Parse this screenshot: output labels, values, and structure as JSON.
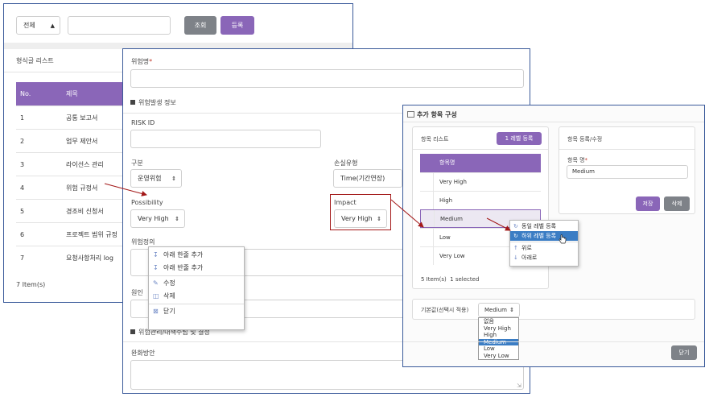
{
  "list_window": {
    "filter_select": "전체",
    "search_button": "조회",
    "register_button": "등록",
    "title": "형식글 리스트",
    "columns": [
      "No.",
      "제목"
    ],
    "rows": [
      {
        "no": "1",
        "title": "공통 보고서"
      },
      {
        "no": "2",
        "title": "업무 제안서"
      },
      {
        "no": "3",
        "title": "라이선스 관리"
      },
      {
        "no": "4",
        "title": "위험 규정서"
      },
      {
        "no": "5",
        "title": "경조비 신청서"
      },
      {
        "no": "6",
        "title": "프로젝트 범위 규정"
      },
      {
        "no": "7",
        "title": "요청사항처리 log"
      }
    ],
    "item_count": "7 Item(s)"
  },
  "form_window": {
    "risk_name_label": "위험명",
    "required_mark": "*",
    "section_occurrence": "위험발생 정보",
    "risk_id_label": "RISK ID",
    "category_label": "구분",
    "category_value": "운영위험",
    "loss_type_label": "손실유형",
    "loss_type_value": "Time(기간연장)",
    "possibility_label": "Possibility",
    "possibility_value": "Very High",
    "impact_label": "Impact",
    "impact_value": "Very High",
    "risk_definition_label": "위험정의",
    "cause_label": "원인",
    "section_mitigation": "위험관리/대책수립 및 결정",
    "mitigation_label": "완화방안"
  },
  "context_menu_1": {
    "items": [
      {
        "label": "아래 한줄 추가",
        "icon": "row-add-icon"
      },
      {
        "label": "아래 반줄 추가",
        "icon": "row-add-icon"
      },
      {
        "label": "수정",
        "icon": "edit-icon"
      },
      {
        "label": "삭제",
        "icon": "trash-icon"
      },
      {
        "label": "닫기",
        "icon": "close-box-icon"
      }
    ]
  },
  "config_window": {
    "title": "추가 항목 구성",
    "list_title": "항목 리스트",
    "level_button": "1 레벨 등록",
    "column_header": "항목명",
    "items": [
      "Very High",
      "High",
      "Medium",
      "Low",
      "Very Low"
    ],
    "selected_item": "Medium",
    "status": "5 Item(s)  1 selected",
    "edit_title": "항목 등록/수정",
    "item_name_label": "항목 명",
    "required_mark": "*",
    "item_name_value": "Medium",
    "save_button": "저장",
    "delete_button": "삭제",
    "default_label": "기본값(선택시 적용)",
    "default_value": "Medium",
    "default_options": [
      "없음",
      "Very High",
      "High",
      "Medium",
      "Low",
      "Very Low"
    ],
    "default_selected": "Medium",
    "close_button": "닫기"
  },
  "context_menu_2": {
    "items": [
      {
        "label": "동일 레벨 등록",
        "icon": "same-level-icon"
      },
      {
        "label": "하위 레벨 등록",
        "icon": "sub-level-icon"
      },
      {
        "label": "위로",
        "icon": "arrow-up-icon"
      },
      {
        "label": "아래로",
        "icon": "arrow-down-icon"
      }
    ],
    "highlighted": "하위 레벨 등록"
  },
  "colors": {
    "accent_purple": "#8a66b8",
    "button_gray": "#7e8288",
    "window_border": "#3a5a9a",
    "highlight_blue": "#3b7dc4",
    "annotation_red": "#a31818"
  }
}
